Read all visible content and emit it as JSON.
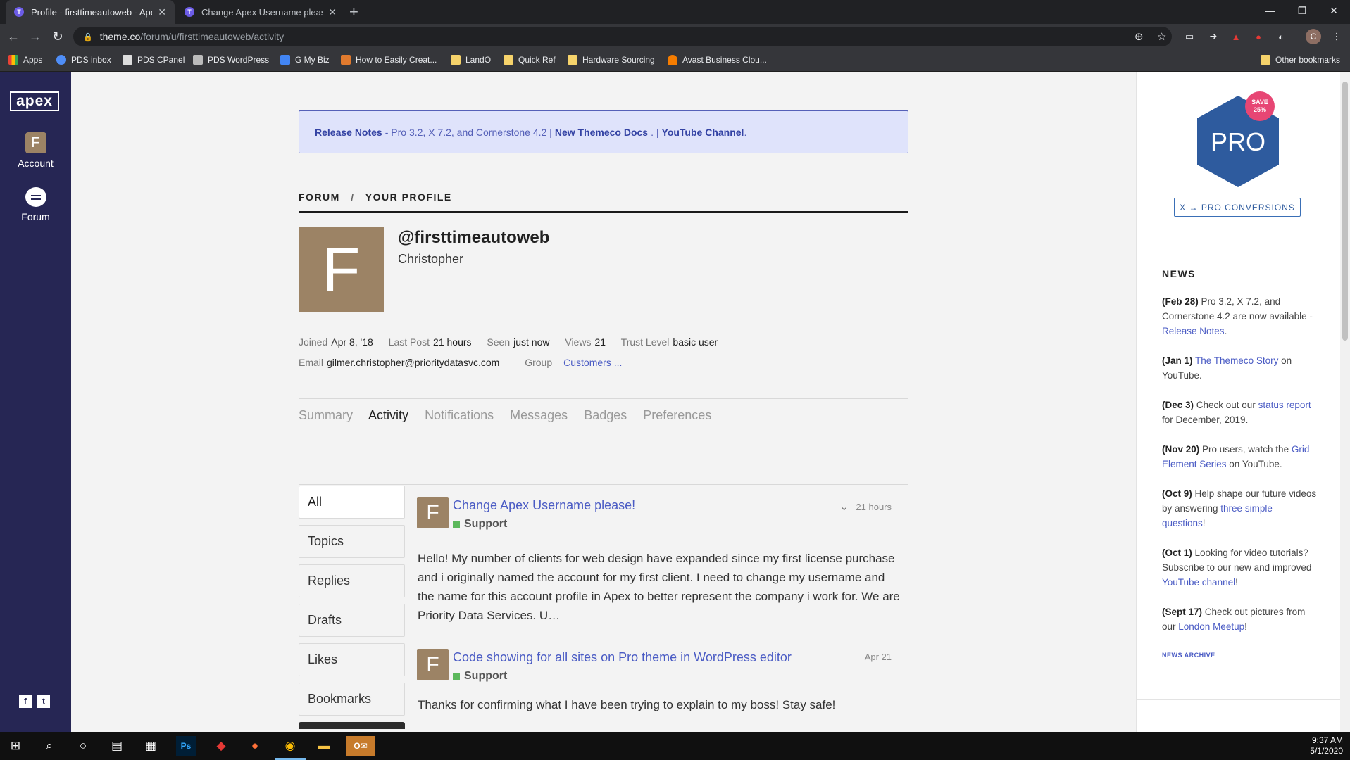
{
  "browser": {
    "tabs": [
      {
        "title": "Profile - firsttimeautoweb - Apex",
        "active": true
      },
      {
        "title": "Change Apex Username please!",
        "active": false
      }
    ],
    "url_host": "theme.co",
    "url_path": "/forum/u/firsttimeautoweb/activity",
    "profile_initial": "C",
    "bookmarks": [
      "Apps",
      "PDS inbox",
      "PDS CPanel",
      "PDS WordPress",
      "G My Biz",
      "How to Easily Creat...",
      "LandO",
      "Quick Ref",
      "Hardware Sourcing",
      "Avast Business Clou...",
      "Other bookmarks"
    ]
  },
  "app_sidebar": {
    "logo": "apex",
    "account_initial": "F",
    "account_label": "Account",
    "forum_label": "Forum",
    "facebook": "f",
    "twitter": "t"
  },
  "notice": {
    "release_notes": "Release Notes",
    "text1": "- Pro 3.2, X 7.2, and Cornerstone 4.2 |",
    "docs": "New Themeco Docs",
    "text2": ". |",
    "youtube": "YouTube Channel",
    "text3": "."
  },
  "breadcrumb": {
    "forum": "FORUM",
    "sep": "/",
    "profile": "YOUR PROFILE"
  },
  "profile": {
    "initial": "F",
    "username": "@firsttimeautoweb",
    "name": "Christopher",
    "joined_label": "Joined",
    "joined": "Apr 8, '18",
    "lastpost_label": "Last Post",
    "lastpost": "21 hours",
    "seen_label": "Seen",
    "seen": "just now",
    "views_label": "Views",
    "views": "21",
    "trust_label": "Trust Level",
    "trust": "basic user",
    "email_label": "Email",
    "email": "gilmer.christopher@prioritydatasvc.com",
    "group_label": "Group",
    "group": "Customers ..."
  },
  "tabs": [
    "Summary",
    "Activity",
    "Notifications",
    "Messages",
    "Badges",
    "Preferences"
  ],
  "filters": [
    "All",
    "Topics",
    "Replies",
    "Drafts",
    "Likes",
    "Bookmarks"
  ],
  "posts": [
    {
      "initial": "F",
      "title": "Change Apex Username please!",
      "category": "Support",
      "time": "21 hours",
      "body": "Hello! My number of clients for web design have expanded since my first license purchase and i originally named the account for my first client. I need to change my username and the name for this account profile in Apex to better represent the company i work for. We are Priority Data Services. U…"
    },
    {
      "initial": "F",
      "title": "Code showing for all sites on Pro theme in WordPress editor",
      "category": "Support",
      "time": "Apr 21",
      "body": "Thanks for confirming what I have been trying to explain to my boss! Stay safe!"
    }
  ],
  "right_sidebar": {
    "pro_text": "PRO",
    "save_line1": "SAVE",
    "save_line2": "25%",
    "conversion_button": "X → PRO CONVERSIONS",
    "news_heading": "NEWS",
    "news_archive": "NEWS ARCHIVE",
    "news": [
      {
        "date": "(Feb 28)",
        "pre": " Pro 3.2, X 7.2, and Cornerstone 4.2 are now available - ",
        "link": "Release Notes",
        "post": "."
      },
      {
        "date": "(Jan 1)",
        "pre": " ",
        "link": "The Themeco Story",
        "post": " on YouTube."
      },
      {
        "date": "(Dec 3)",
        "pre": " Check out our ",
        "link": "status report",
        "post": " for December, 2019."
      },
      {
        "date": "(Nov 20)",
        "pre": " Pro users, watch the ",
        "link": "Grid Element Series",
        "post": " on YouTube."
      },
      {
        "date": "(Oct 9)",
        "pre": " Help shape our future videos by answering ",
        "link": "three simple questions",
        "post": "!"
      },
      {
        "date": "(Oct 1)",
        "pre": " Looking for video tutorials? Subscribe to our new and improved ",
        "link": "YouTube channel",
        "post": "!"
      },
      {
        "date": "(Sept 17)",
        "pre": " Check out pictures from our ",
        "link": "London Meetup",
        "post": "!"
      }
    ]
  },
  "taskbar": {
    "time": "9:37 AM",
    "date": "5/1/2020"
  },
  "colors": {
    "sidebar": "#262654",
    "accent": "#4a5bc4",
    "avatar": "#9c8365",
    "pro": "#2e5b9e",
    "save": "#e74674"
  }
}
